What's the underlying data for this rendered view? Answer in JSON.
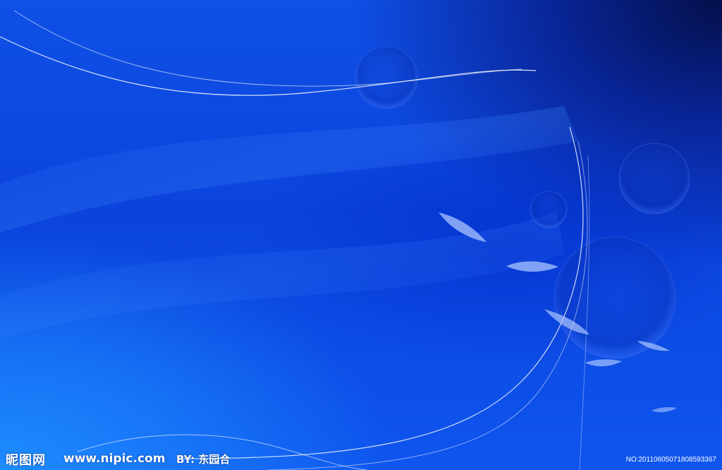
{
  "watermark": {
    "site_name": "昵图网",
    "site_url": "www.nipic.com",
    "author": "BY: 东园合",
    "image_no": "NO:20110605071808593367"
  },
  "colors": {
    "base_blue": "#0b44dc",
    "dark_corner": "#050f4a",
    "light_corner": "#1e8cff",
    "line_white": "#ffffff"
  }
}
